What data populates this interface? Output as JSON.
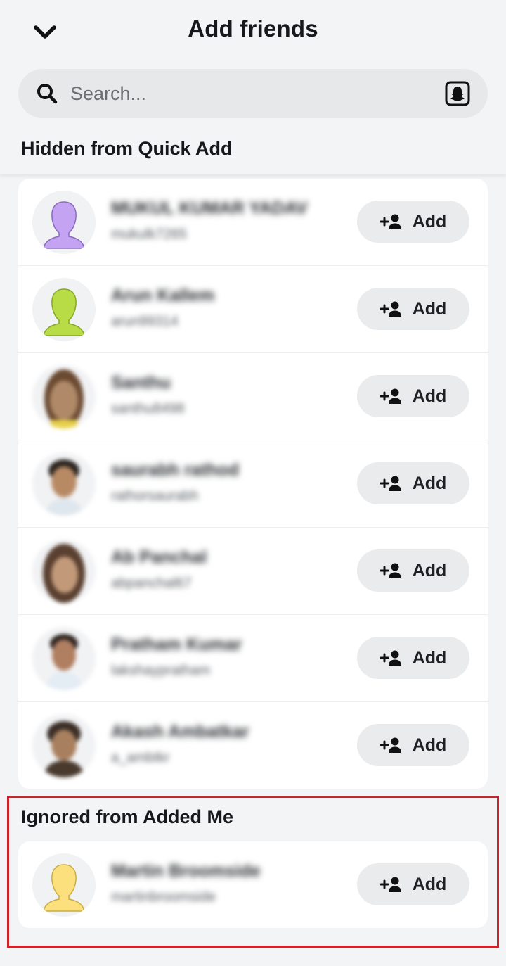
{
  "header": {
    "title": "Add friends"
  },
  "search": {
    "placeholder": "Search..."
  },
  "sections": {
    "hidden_quick_add": {
      "title": "Hidden from Quick Add",
      "items": [
        {
          "name": "MUKUL KUMAR YADAV",
          "username": "mukulk7265",
          "button": "Add"
        },
        {
          "name": "Arun Kallem",
          "username": "arun99314",
          "button": "Add"
        },
        {
          "name": "Santhu",
          "username": "santhu8498",
          "button": "Add"
        },
        {
          "name": "saurabh rathod",
          "username": "rathorsaurabh",
          "button": "Add"
        },
        {
          "name": "Ab Panchal",
          "username": "abpanchal67",
          "button": "Add"
        },
        {
          "name": "Pratham Kumar",
          "username": "lakshaypratham",
          "button": "Add"
        },
        {
          "name": "Akash Ambatkar",
          "username": "a_ambtkr",
          "button": "Add"
        }
      ]
    },
    "ignored_added_me": {
      "title": "Ignored from Added Me",
      "items": [
        {
          "name": "Martin Broomside",
          "username": "martinbroomside",
          "button": "Add"
        }
      ]
    }
  },
  "colors": {
    "highlight_border": "#cc2229",
    "avatar_purple": "#c3a3f2",
    "avatar_green": "#b8dc45",
    "avatar_yellow": "#fbe07d"
  },
  "icons": [
    "chevron-down-icon",
    "search-icon",
    "snapcode-icon",
    "add-friend-icon",
    "bitmoji-silhouette-icon"
  ]
}
